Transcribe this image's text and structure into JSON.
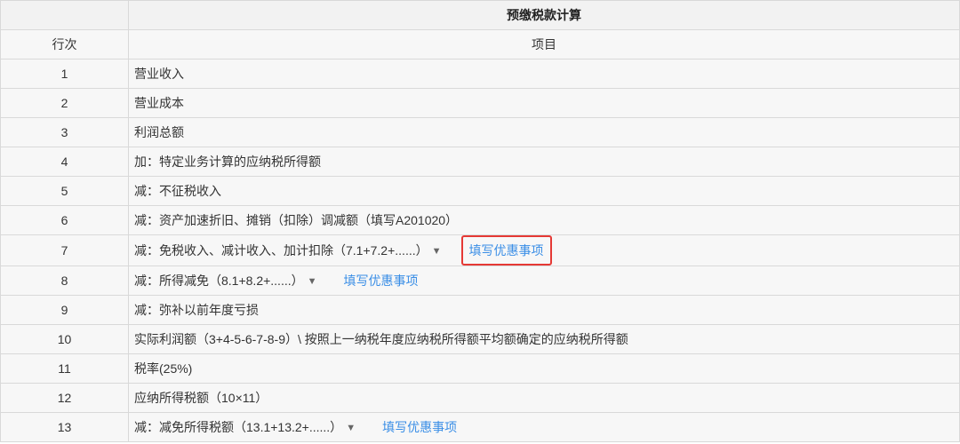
{
  "header": {
    "group_title": "预缴税款计算",
    "col_index": "行次",
    "col_item": "项目"
  },
  "rows": [
    {
      "num": "1",
      "label": "营业收入"
    },
    {
      "num": "2",
      "label": "营业成本"
    },
    {
      "num": "3",
      "label": "利润总额"
    },
    {
      "num": "4",
      "label": "加：特定业务计算的应纳税所得额"
    },
    {
      "num": "5",
      "label": "减：不征税收入"
    },
    {
      "num": "6",
      "label": "减：资产加速折旧、摊销（扣除）调减额（填写A201020）"
    },
    {
      "num": "7",
      "label": "减：免税收入、减计收入、加计扣除（7.1+7.2+......）",
      "link": "填写优惠事项"
    },
    {
      "num": "8",
      "label": "减：所得减免（8.1+8.2+......）",
      "link": "填写优惠事项"
    },
    {
      "num": "9",
      "label": "减：弥补以前年度亏损"
    },
    {
      "num": "10",
      "label": "实际利润额（3+4-5-6-7-8-9）\\ 按照上一纳税年度应纳税所得额平均额确定的应纳税所得额"
    },
    {
      "num": "11",
      "label": "税率(25%)"
    },
    {
      "num": "12",
      "label": "应纳所得税额（10×11）"
    },
    {
      "num": "13",
      "label": "减：减免所得税额（13.1+13.2+......）",
      "link": "填写优惠事项"
    }
  ],
  "colors": {
    "link": "#3a8ee6",
    "highlight_border": "#e53935",
    "row_bg": "#f7f7f7",
    "border": "#d9d9d9"
  },
  "icons": {
    "dropdown": "caret-down-icon"
  }
}
